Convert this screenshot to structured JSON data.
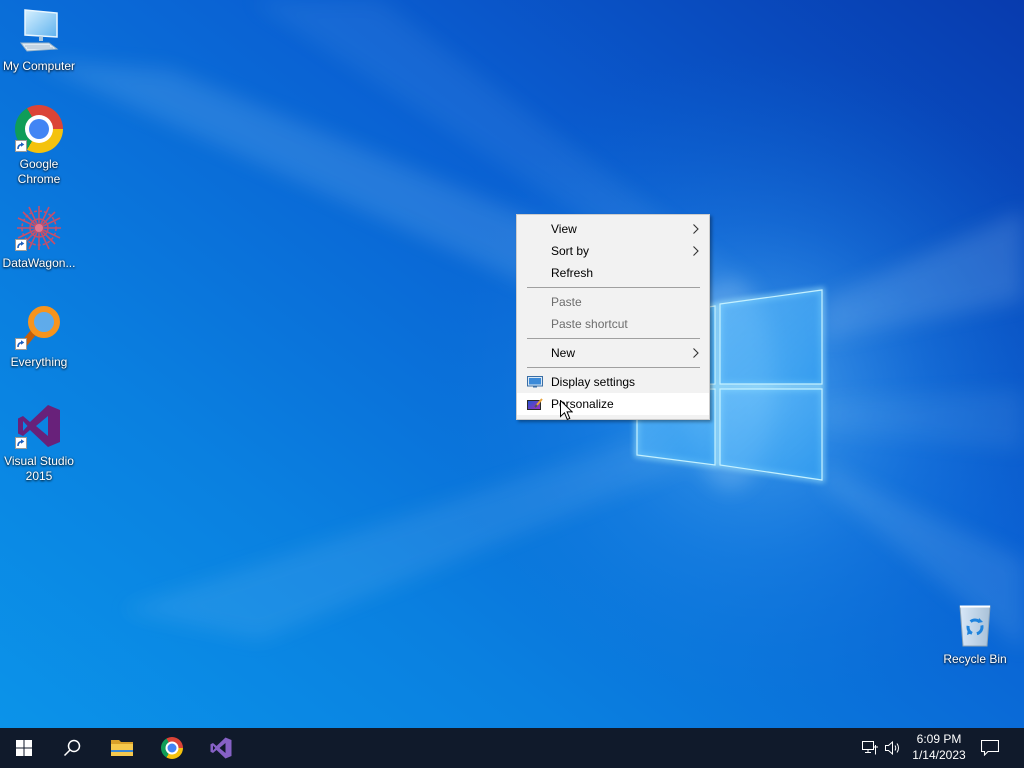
{
  "theme": {
    "menu_background": "#f2f2f2",
    "menu_border": "#cccccc",
    "menu_hover": "#ffffff",
    "menu_disabled_text": "#6d6d6d",
    "taskbar_background": "#101a2b",
    "desktop_label_color": "#ffffff"
  },
  "desktop": {
    "icons": [
      {
        "label": "My Computer",
        "icon": "computer-icon",
        "shortcut": false
      },
      {
        "label": "Google Chrome",
        "icon": "chrome-icon",
        "shortcut": true
      },
      {
        "label": "DataWagon...",
        "icon": "datawagon-icon",
        "shortcut": true
      },
      {
        "label": "Everything",
        "icon": "everything-search-icon",
        "shortcut": true
      },
      {
        "label": "Visual Studio 2015",
        "icon": "visual-studio-icon",
        "shortcut": true
      }
    ],
    "recycle_bin": {
      "label": "Recycle Bin",
      "icon": "recycle-bin-icon"
    }
  },
  "context_menu": {
    "items": [
      {
        "label": "View",
        "enabled": true,
        "submenu": true
      },
      {
        "label": "Sort by",
        "enabled": true,
        "submenu": true
      },
      {
        "label": "Refresh",
        "enabled": true,
        "submenu": false
      },
      {
        "label": "Paste",
        "enabled": false,
        "submenu": false
      },
      {
        "label": "Paste shortcut",
        "enabled": false,
        "submenu": false
      },
      {
        "label": "New",
        "enabled": true,
        "submenu": true
      },
      {
        "label": "Display settings",
        "enabled": true,
        "submenu": false,
        "icon": "display-settings-icon"
      },
      {
        "label": "Personalize",
        "enabled": true,
        "submenu": false,
        "icon": "personalize-icon",
        "hovered": true
      }
    ]
  },
  "taskbar": {
    "buttons": [
      {
        "icon": "windows-start-icon"
      },
      {
        "icon": "search-icon"
      },
      {
        "icon": "file-explorer-icon"
      },
      {
        "icon": "chrome-icon"
      },
      {
        "icon": "visual-studio-icon"
      }
    ],
    "tray": {
      "icons": [
        "network-icon",
        "volume-icon",
        "notification-icon"
      ],
      "clock": {
        "time": "6:09 PM",
        "date": "1/14/2023"
      }
    }
  },
  "cursor": {
    "icon": "mouse-pointer-icon"
  }
}
